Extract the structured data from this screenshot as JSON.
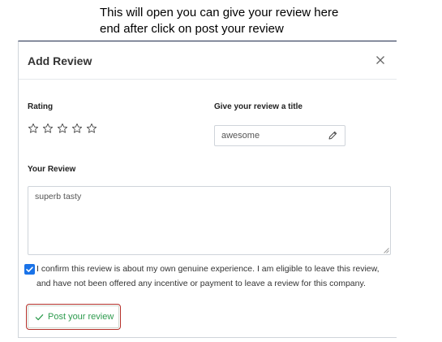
{
  "caption": {
    "line1": "This will open you can give your review here",
    "line2": "end after click on post your review"
  },
  "modal": {
    "title": "Add Review",
    "close_icon": "close-icon",
    "rating": {
      "label": "Rating",
      "stars_total": 5,
      "stars_selected": 0,
      "icon": "star-outline-icon"
    },
    "review_title": {
      "label": "Give your review a title",
      "value": "awesome",
      "icon": "pencil-icon"
    },
    "review_body": {
      "label": "Your Review",
      "value": "superb tasty"
    },
    "confirm": {
      "checked": true,
      "text": "I confirm this review is about my own genuine experience. I am eligible to leave this review, and have not been offered any incentive or payment to leave a review for this company."
    },
    "submit": {
      "label": "Post your review",
      "icon": "check-icon",
      "color": "#2e9b4e",
      "highlight_color": "#b5302a"
    }
  },
  "colors": {
    "checkbox": "#1a73e8"
  }
}
